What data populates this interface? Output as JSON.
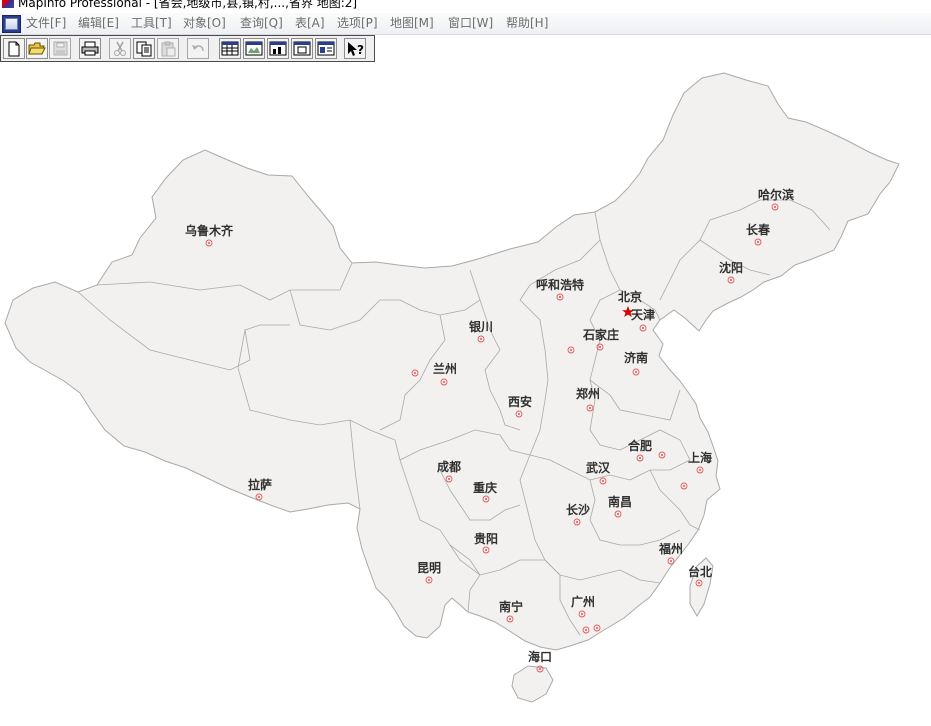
{
  "window": {
    "title": "MapInfo Professional - [省会,地级市,县,镇,村,...,省界 地图:2]"
  },
  "menu": [
    {
      "label": "文件[F]"
    },
    {
      "label": "编辑[E]"
    },
    {
      "label": "工具[T]"
    },
    {
      "label": "对象[O]"
    },
    {
      "label": "查询[Q]"
    },
    {
      "label": "表[A]"
    },
    {
      "label": "选项[P]"
    },
    {
      "label": "地图[M]"
    },
    {
      "label": "窗口[W]"
    },
    {
      "label": "帮助[H]"
    }
  ],
  "toolbar": {
    "buttons": [
      {
        "icon": "new-document-icon",
        "enabled": true
      },
      {
        "icon": "open-folder-icon",
        "enabled": true
      },
      {
        "icon": "save-icon",
        "enabled": false
      },
      {
        "icon": "print-icon",
        "enabled": true
      },
      {
        "icon": "cut-icon",
        "enabled": false
      },
      {
        "icon": "copy-icon",
        "enabled": true
      },
      {
        "icon": "paste-icon",
        "enabled": false
      },
      {
        "icon": "undo-icon",
        "enabled": false
      },
      {
        "icon": "browser-window-icon",
        "enabled": true
      },
      {
        "icon": "map-window-icon",
        "enabled": true
      },
      {
        "icon": "graph-window-icon",
        "enabled": true
      },
      {
        "icon": "layout-window-icon",
        "enabled": true
      },
      {
        "icon": "redistrict-window-icon",
        "enabled": true
      },
      {
        "icon": "help-pointer-icon",
        "enabled": true
      }
    ]
  },
  "map": {
    "land_color": "#f2f1ef",
    "border_color": "#a9a9a9",
    "city_marker_color": "#e05a5a",
    "capital_marker_color": "#d40000",
    "cities": [
      {
        "name": "乌鲁木齐"
      },
      {
        "name": "哈尔滨"
      },
      {
        "name": "长春"
      },
      {
        "name": "沈阳"
      },
      {
        "name": "呼和浩特"
      },
      {
        "name": "北京"
      },
      {
        "name": "天津"
      },
      {
        "name": "银川"
      },
      {
        "name": "石家庄"
      },
      {
        "name": "兰州"
      },
      {
        "name": "济南"
      },
      {
        "name": "西安"
      },
      {
        "name": "郑州"
      },
      {
        "name": "合肥"
      },
      {
        "name": "上海"
      },
      {
        "name": "拉萨"
      },
      {
        "name": "成都"
      },
      {
        "name": "武汉"
      },
      {
        "name": "重庆"
      },
      {
        "name": "南昌"
      },
      {
        "name": "长沙"
      },
      {
        "name": "贵阳"
      },
      {
        "name": "福州"
      },
      {
        "name": "昆明"
      },
      {
        "name": "台北"
      },
      {
        "name": "南宁"
      },
      {
        "name": "广州"
      },
      {
        "name": "海口"
      }
    ]
  }
}
